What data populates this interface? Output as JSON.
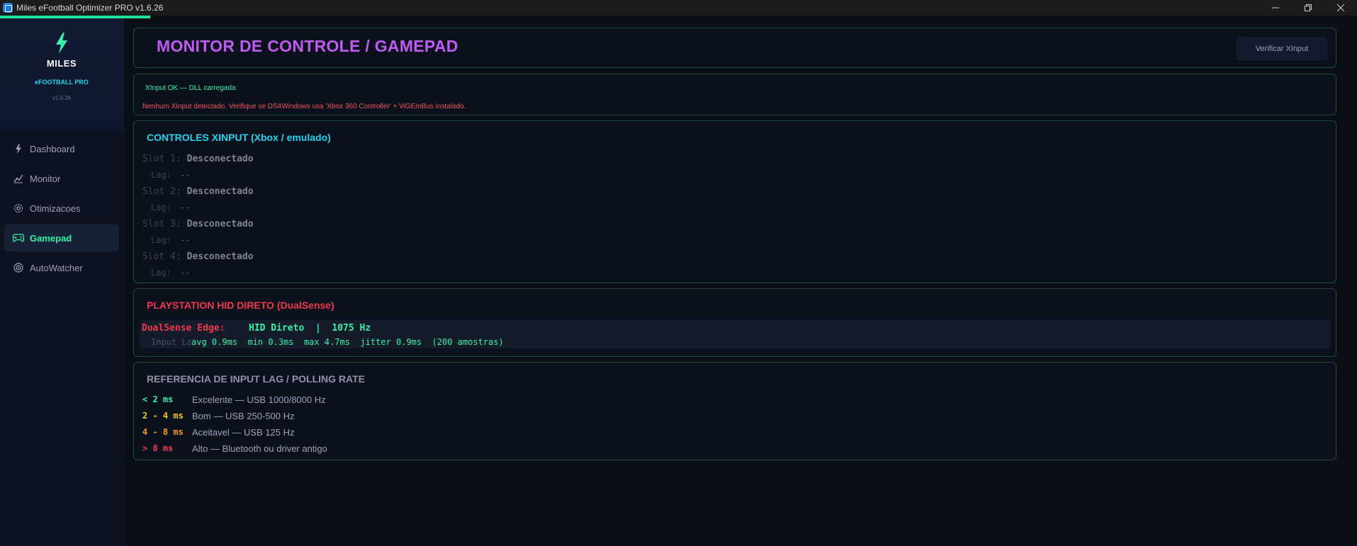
{
  "window": {
    "title": "Miles eFootball Optimizer PRO v1.6.26"
  },
  "sidebar": {
    "brand_name": "MILES",
    "brand_sub": "eFOOTBALL PRO",
    "version": "v1.6.26",
    "items": [
      {
        "label": "Dashboard",
        "icon": "bolt-icon"
      },
      {
        "label": "Monitor",
        "icon": "monitor-pulse-icon"
      },
      {
        "label": "Otimizacoes",
        "icon": "gear-icon"
      },
      {
        "label": "Gamepad",
        "icon": "gamepad-icon",
        "active": true
      },
      {
        "label": "AutoWatcher",
        "icon": "eye-icon"
      }
    ]
  },
  "header": {
    "title": "MONITOR DE CONTROLE / GAMEPAD",
    "verify_button": "Verificar XInput"
  },
  "status": {
    "ok": "XInput OK — DLL carregada",
    "error": "Nenhum XInput detectado. Verifique se DS4Windows usa 'Xbox 360 Controller' + ViGEmBus instalado."
  },
  "xinput": {
    "title": "CONTROLES XINPUT (Xbox / emulado)",
    "lag_label": "Lag:",
    "slots": [
      {
        "label": "Slot 1:",
        "status": "Desconectado",
        "lag": "--"
      },
      {
        "label": "Slot 2:",
        "status": "Desconectado",
        "lag": "--"
      },
      {
        "label": "Slot 3:",
        "status": "Desconectado",
        "lag": "--"
      },
      {
        "label": "Slot 4:",
        "status": "Desconectado",
        "lag": "--"
      }
    ]
  },
  "hid": {
    "title": "PLAYSTATION HID DIRETO (DualSense)",
    "device": "DualSense Edge:",
    "info": "HID Direto  |  1075 Hz",
    "input_lag_label": "Input Lag:",
    "stats": "avg 0.9ms  min 0.3ms  max 4.7ms  jitter 0.9ms  (200 amostras)"
  },
  "reference": {
    "title": "REFERENCIA DE INPUT LAG / POLLING RATE",
    "rows": [
      {
        "range": "< 2 ms",
        "desc": "Excelente — USB 1000/8000 Hz",
        "color": "#34f2a8"
      },
      {
        "range": "2 - 4 ms",
        "desc": "Bom — USB 250-500 Hz",
        "color": "#f5c518"
      },
      {
        "range": "4 - 8 ms",
        "desc": "Aceitavel — USB 125 Hz",
        "color": "#f59e0b"
      },
      {
        "range": "> 8 ms",
        "desc": "Alto — Bluetooth ou driver antigo",
        "color": "#f0374f"
      }
    ]
  },
  "colors": {
    "accent_green": "#34f2a8",
    "accent_purple": "#c15bf3",
    "accent_cyan": "#22d3ee",
    "accent_red": "#f0374f"
  }
}
